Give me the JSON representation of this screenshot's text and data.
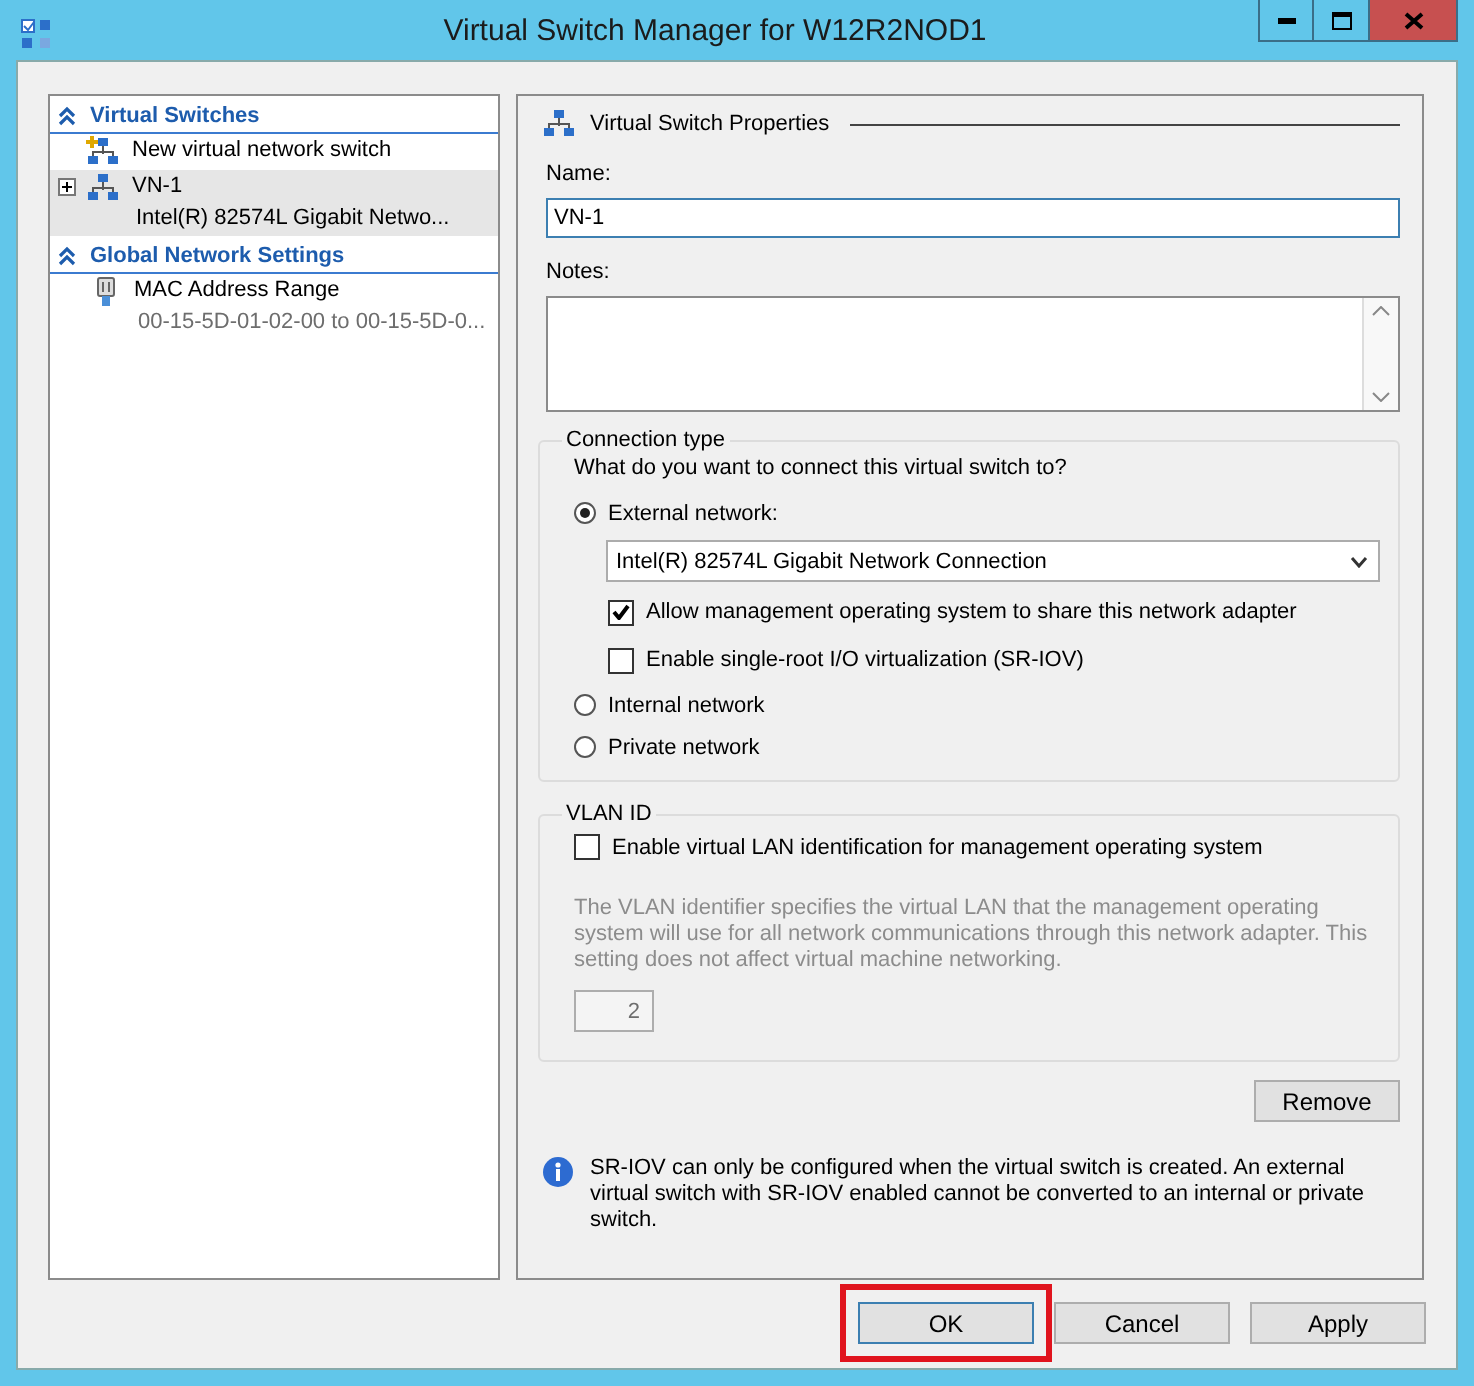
{
  "window": {
    "title": "Virtual Switch Manager for W12R2NOD1"
  },
  "sidebar": {
    "sections": [
      {
        "title": "Virtual Switches",
        "expanded": true,
        "items": [
          {
            "kind": "new",
            "label": "New virtual network switch",
            "selected": false
          },
          {
            "kind": "switch",
            "label": "VN-1",
            "detail": "Intel(R) 82574L Gigabit Netwo...",
            "selected": true,
            "expanded": false
          }
        ]
      },
      {
        "title": "Global Network Settings",
        "expanded": true,
        "items": [
          {
            "kind": "setting",
            "label": "MAC Address Range",
            "detail": "00-15-5D-01-02-00 to 00-15-5D-0...",
            "selected": false
          }
        ]
      }
    ]
  },
  "properties": {
    "title": "Virtual Switch Properties",
    "name": {
      "label": "Name:",
      "value": "VN-1"
    },
    "notes": {
      "label": "Notes:"
    },
    "connection_type": {
      "title": "Connection type",
      "question": "What do you want to connect this virtual switch to?",
      "options": [
        {
          "label": "External network:",
          "selected": true
        },
        {
          "label": "Internal network",
          "selected": false
        },
        {
          "label": "Private network",
          "selected": false
        }
      ],
      "adapter": "Intel(R) 82574L Gigabit Network Connection",
      "checkboxes": [
        {
          "label": "Allow management operating system to share this network adapter",
          "checked": true
        },
        {
          "label": "Enable single-root I/O virtualization (SR-IOV)",
          "checked": false
        }
      ]
    },
    "vlan": {
      "title": "VLAN ID",
      "checkbox": {
        "label": "Enable virtual LAN identification for management operating system",
        "checked": false
      },
      "description": "The VLAN identifier specifies the virtual LAN that the management operating system will use for all network communications through this network adapter. This setting does not affect virtual machine networking.",
      "value": "2",
      "disabled": true
    },
    "remove_button": "Remove",
    "info": "SR-IOV can only be configured when the virtual switch is created. An external virtual switch with SR-IOV enabled cannot be converted to an internal or private switch."
  },
  "buttons": [
    {
      "label": "OK",
      "highlighted": true
    },
    {
      "label": "Cancel",
      "highlighted": false
    },
    {
      "label": "Apply",
      "highlighted": false
    }
  ]
}
